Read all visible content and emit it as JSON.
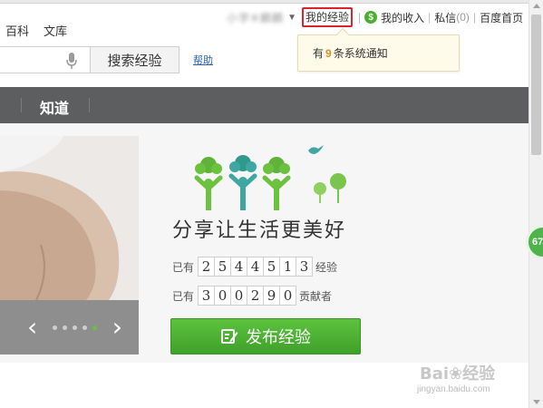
{
  "nav": {
    "baike": "百科",
    "wenku": "文库"
  },
  "userbar": {
    "username": "小学※麟麟",
    "my_experience": "我的经验",
    "coin_icon": "$",
    "my_income": "我的收入",
    "messages_label": "私信",
    "messages_count": "(0)",
    "baidu_home": "百度首页"
  },
  "notice": {
    "prefix": "有",
    "count": "9",
    "suffix": "条系统通知"
  },
  "search": {
    "button_label": "搜索经验",
    "help_label": "帮助"
  },
  "darkbar": {
    "zhidao": "知道"
  },
  "slideshow": {
    "prev": "‹",
    "next": "›",
    "dots_total": 5,
    "active_index": 4
  },
  "hero": {
    "slogan": "分享让生活更美好",
    "stats": [
      {
        "prefix": "已有",
        "digits": [
          "2",
          "5",
          "4",
          "4",
          "5",
          "1",
          "3"
        ],
        "suffix": "经验"
      },
      {
        "prefix": "已有",
        "digits": [
          "3",
          "0",
          "0",
          "2",
          "9",
          "0"
        ],
        "suffix": "贡献者"
      }
    ],
    "publish_label": "发布经验"
  },
  "floating": {
    "badge": "67"
  },
  "watermark": {
    "brand": "Bai❀经验",
    "url": "jingyan.baidu.com"
  },
  "colors": {
    "accent_green": "#4cae2d",
    "highlight_red": "#d9262c",
    "dark_bar": "#5d5e60",
    "link_blue": "#2c64b5",
    "notice_count": "#e5892b"
  }
}
